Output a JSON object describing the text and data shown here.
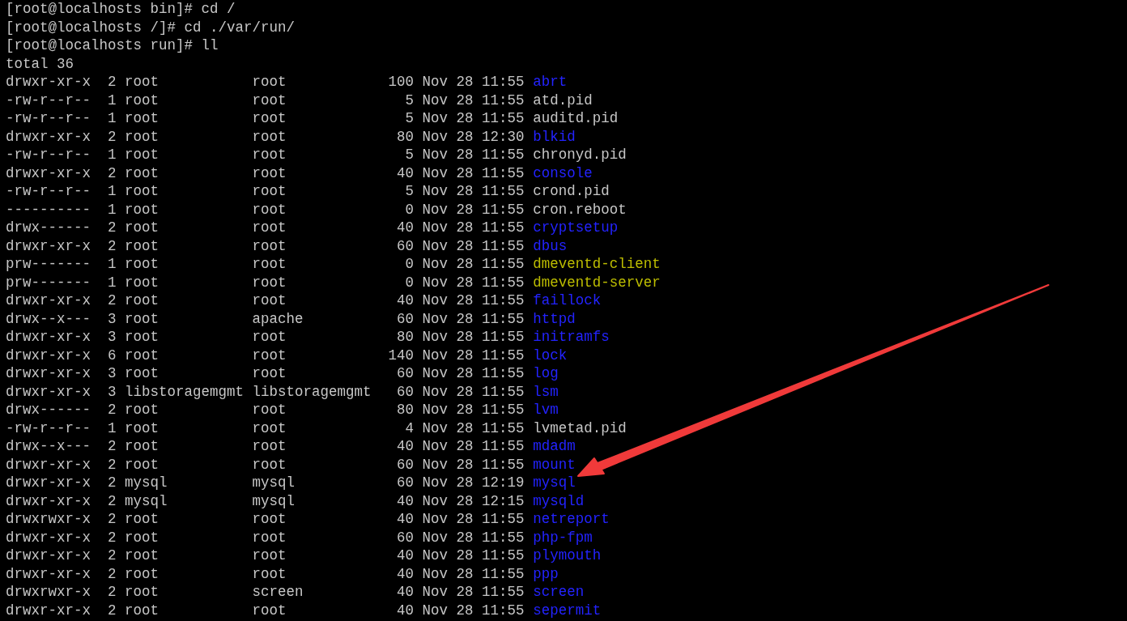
{
  "terminal": {
    "commands": [
      {
        "text": "[root@localhosts bin]# cd /"
      },
      {
        "text": "[root@localhosts /]# cd ./var/run/"
      },
      {
        "text": "[root@localhosts run]# ll"
      }
    ],
    "total": "total 36",
    "entries": [
      {
        "mode": "drwxr-xr-x",
        "links": "2",
        "owner": "root",
        "group": "root",
        "size": "100",
        "date": "Nov 28 11:55",
        "name": "abrt",
        "kind": "dir"
      },
      {
        "mode": "-rw-r--r--",
        "links": "1",
        "owner": "root",
        "group": "root",
        "size": "5",
        "date": "Nov 28 11:55",
        "name": "atd.pid",
        "kind": "file"
      },
      {
        "mode": "-rw-r--r--",
        "links": "1",
        "owner": "root",
        "group": "root",
        "size": "5",
        "date": "Nov 28 11:55",
        "name": "auditd.pid",
        "kind": "file"
      },
      {
        "mode": "drwxr-xr-x",
        "links": "2",
        "owner": "root",
        "group": "root",
        "size": "80",
        "date": "Nov 28 12:30",
        "name": "blkid",
        "kind": "dir"
      },
      {
        "mode": "-rw-r--r--",
        "links": "1",
        "owner": "root",
        "group": "root",
        "size": "5",
        "date": "Nov 28 11:55",
        "name": "chronyd.pid",
        "kind": "file"
      },
      {
        "mode": "drwxr-xr-x",
        "links": "2",
        "owner": "root",
        "group": "root",
        "size": "40",
        "date": "Nov 28 11:55",
        "name": "console",
        "kind": "dir"
      },
      {
        "mode": "-rw-r--r--",
        "links": "1",
        "owner": "root",
        "group": "root",
        "size": "5",
        "date": "Nov 28 11:55",
        "name": "crond.pid",
        "kind": "file"
      },
      {
        "mode": "----------",
        "links": "1",
        "owner": "root",
        "group": "root",
        "size": "0",
        "date": "Nov 28 11:55",
        "name": "cron.reboot",
        "kind": "file"
      },
      {
        "mode": "drwx------",
        "links": "2",
        "owner": "root",
        "group": "root",
        "size": "40",
        "date": "Nov 28 11:55",
        "name": "cryptsetup",
        "kind": "dir"
      },
      {
        "mode": "drwxr-xr-x",
        "links": "2",
        "owner": "root",
        "group": "root",
        "size": "60",
        "date": "Nov 28 11:55",
        "name": "dbus",
        "kind": "dir"
      },
      {
        "mode": "prw-------",
        "links": "1",
        "owner": "root",
        "group": "root",
        "size": "0",
        "date": "Nov 28 11:55",
        "name": "dmeventd-client",
        "kind": "pipe"
      },
      {
        "mode": "prw-------",
        "links": "1",
        "owner": "root",
        "group": "root",
        "size": "0",
        "date": "Nov 28 11:55",
        "name": "dmeventd-server",
        "kind": "pipe"
      },
      {
        "mode": "drwxr-xr-x",
        "links": "2",
        "owner": "root",
        "group": "root",
        "size": "40",
        "date": "Nov 28 11:55",
        "name": "faillock",
        "kind": "dir"
      },
      {
        "mode": "drwx--x---",
        "links": "3",
        "owner": "root",
        "group": "apache",
        "size": "60",
        "date": "Nov 28 11:55",
        "name": "httpd",
        "kind": "dir"
      },
      {
        "mode": "drwxr-xr-x",
        "links": "3",
        "owner": "root",
        "group": "root",
        "size": "80",
        "date": "Nov 28 11:55",
        "name": "initramfs",
        "kind": "dir"
      },
      {
        "mode": "drwxr-xr-x",
        "links": "6",
        "owner": "root",
        "group": "root",
        "size": "140",
        "date": "Nov 28 11:55",
        "name": "lock",
        "kind": "dir"
      },
      {
        "mode": "drwxr-xr-x",
        "links": "3",
        "owner": "root",
        "group": "root",
        "size": "60",
        "date": "Nov 28 11:55",
        "name": "log",
        "kind": "dir"
      },
      {
        "mode": "drwxr-xr-x",
        "links": "3",
        "owner": "libstoragemgmt",
        "group": "libstoragemgmt",
        "size": "60",
        "date": "Nov 28 11:55",
        "name": "lsm",
        "kind": "dir"
      },
      {
        "mode": "drwx------",
        "links": "2",
        "owner": "root",
        "group": "root",
        "size": "80",
        "date": "Nov 28 11:55",
        "name": "lvm",
        "kind": "dir"
      },
      {
        "mode": "-rw-r--r--",
        "links": "1",
        "owner": "root",
        "group": "root",
        "size": "4",
        "date": "Nov 28 11:55",
        "name": "lvmetad.pid",
        "kind": "file"
      },
      {
        "mode": "drwx--x---",
        "links": "2",
        "owner": "root",
        "group": "root",
        "size": "40",
        "date": "Nov 28 11:55",
        "name": "mdadm",
        "kind": "dir"
      },
      {
        "mode": "drwxr-xr-x",
        "links": "2",
        "owner": "root",
        "group": "root",
        "size": "60",
        "date": "Nov 28 11:55",
        "name": "mount",
        "kind": "dir"
      },
      {
        "mode": "drwxr-xr-x",
        "links": "2",
        "owner": "mysql",
        "group": "mysql",
        "size": "60",
        "date": "Nov 28 12:19",
        "name": "mysql",
        "kind": "dir"
      },
      {
        "mode": "drwxr-xr-x",
        "links": "2",
        "owner": "mysql",
        "group": "mysql",
        "size": "40",
        "date": "Nov 28 12:15",
        "name": "mysqld",
        "kind": "dir"
      },
      {
        "mode": "drwxrwxr-x",
        "links": "2",
        "owner": "root",
        "group": "root",
        "size": "40",
        "date": "Nov 28 11:55",
        "name": "netreport",
        "kind": "dir"
      },
      {
        "mode": "drwxr-xr-x",
        "links": "2",
        "owner": "root",
        "group": "root",
        "size": "60",
        "date": "Nov 28 11:55",
        "name": "php-fpm",
        "kind": "dir"
      },
      {
        "mode": "drwxr-xr-x",
        "links": "2",
        "owner": "root",
        "group": "root",
        "size": "40",
        "date": "Nov 28 11:55",
        "name": "plymouth",
        "kind": "dir"
      },
      {
        "mode": "drwxr-xr-x",
        "links": "2",
        "owner": "root",
        "group": "root",
        "size": "40",
        "date": "Nov 28 11:55",
        "name": "ppp",
        "kind": "dir"
      },
      {
        "mode": "drwxrwxr-x",
        "links": "2",
        "owner": "root",
        "group": "screen",
        "size": "40",
        "date": "Nov 28 11:55",
        "name": "screen",
        "kind": "dir"
      },
      {
        "mode": "drwxr-xr-x",
        "links": "2",
        "owner": "root",
        "group": "root",
        "size": "40",
        "date": "Nov 28 11:55",
        "name": "sepermit",
        "kind": "dir"
      }
    ]
  },
  "annotations": [
    {
      "kind": "arrow"
    }
  ]
}
